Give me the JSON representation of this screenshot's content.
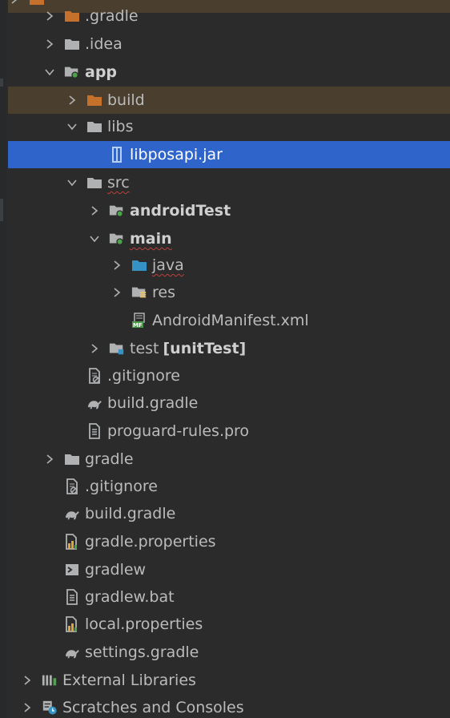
{
  "tree": [
    {
      "label": "",
      "icon": "folder-excluded-icon",
      "bold": false,
      "arrow": "collapsed",
      "hl": "ignored",
      "extra": ""
    },
    {
      "label": ".gradle",
      "icon": "folder-excluded-icon",
      "bold": false,
      "arrow": "collapsed",
      "hl": "",
      "extra": ""
    },
    {
      "label": ".idea",
      "icon": "folder-icon",
      "bold": false,
      "arrow": "collapsed",
      "hl": "",
      "extra": ""
    },
    {
      "label": "app",
      "icon": "module-folder-icon",
      "bold": true,
      "arrow": "expanded",
      "hl": "",
      "extra": ""
    },
    {
      "label": "build",
      "icon": "folder-excluded-icon",
      "bold": false,
      "arrow": "collapsed",
      "hl": "ignored",
      "extra": ""
    },
    {
      "label": "libs",
      "icon": "folder-icon",
      "bold": false,
      "arrow": "expanded",
      "hl": "",
      "extra": ""
    },
    {
      "label": "libposapi.jar",
      "icon": "jar-file-icon",
      "bold": false,
      "arrow": "none",
      "hl": "selected",
      "extra": ""
    },
    {
      "label": "src",
      "icon": "folder-icon",
      "bold": false,
      "arrow": "expanded",
      "hl": "",
      "extra": ""
    },
    {
      "label": "androidTest",
      "icon": "module-folder-icon",
      "bold": true,
      "arrow": "collapsed",
      "hl": "",
      "extra": ""
    },
    {
      "label": "main",
      "icon": "module-folder-icon",
      "bold": true,
      "arrow": "expanded",
      "hl": "",
      "extra": ""
    },
    {
      "label": "java",
      "icon": "source-folder-icon",
      "bold": false,
      "arrow": "collapsed",
      "hl": "",
      "extra": ""
    },
    {
      "label": "res",
      "icon": "resource-folder-icon",
      "bold": false,
      "arrow": "collapsed",
      "hl": "",
      "extra": ""
    },
    {
      "label": "AndroidManifest.xml",
      "icon": "manifest-file-icon",
      "bold": false,
      "arrow": "none",
      "hl": "",
      "extra": ""
    },
    {
      "label": "test",
      "icon": "test-folder-icon",
      "bold": false,
      "arrow": "collapsed",
      "hl": "",
      "extra": "[unitTest]"
    },
    {
      "label": ".gitignore",
      "icon": "gitignore-file-icon",
      "bold": false,
      "arrow": "none",
      "hl": "",
      "extra": ""
    },
    {
      "label": "build.gradle",
      "icon": "gradle-file-icon",
      "bold": false,
      "arrow": "none",
      "hl": "",
      "extra": ""
    },
    {
      "label": "proguard-rules.pro",
      "icon": "text-file-icon",
      "bold": false,
      "arrow": "none",
      "hl": "",
      "extra": ""
    },
    {
      "label": "gradle",
      "icon": "folder-icon",
      "bold": false,
      "arrow": "collapsed",
      "hl": "",
      "extra": ""
    },
    {
      "label": ".gitignore",
      "icon": "gitignore-file-icon",
      "bold": false,
      "arrow": "none",
      "hl": "",
      "extra": ""
    },
    {
      "label": "build.gradle",
      "icon": "gradle-file-icon",
      "bold": false,
      "arrow": "none",
      "hl": "",
      "extra": ""
    },
    {
      "label": "gradle.properties",
      "icon": "properties-file-icon",
      "bold": false,
      "arrow": "none",
      "hl": "",
      "extra": ""
    },
    {
      "label": "gradlew",
      "icon": "shell-script-icon",
      "bold": false,
      "arrow": "none",
      "hl": "",
      "extra": ""
    },
    {
      "label": "gradlew.bat",
      "icon": "text-file-icon",
      "bold": false,
      "arrow": "none",
      "hl": "",
      "extra": ""
    },
    {
      "label": "local.properties",
      "icon": "properties-file-icon",
      "bold": false,
      "arrow": "none",
      "hl": "",
      "extra": ""
    },
    {
      "label": "settings.gradle",
      "icon": "gradle-file-icon",
      "bold": false,
      "arrow": "none",
      "hl": "",
      "extra": ""
    },
    {
      "label": "External Libraries",
      "icon": "library-icon",
      "bold": false,
      "arrow": "collapsed",
      "hl": "",
      "extra": ""
    },
    {
      "label": "Scratches and Consoles",
      "icon": "scratches-icon",
      "bold": false,
      "arrow": "collapsed",
      "hl": "",
      "extra": ""
    }
  ],
  "colors": {
    "background": "#2b2b2b",
    "selected": "#2f65ca",
    "ignored": "#4a3f2e",
    "text": "#bbbbbb",
    "folder": "#afb1b3",
    "excluded_folder": "#c5712b",
    "source_folder": "#3592c4",
    "module_dot": "#49a647"
  }
}
